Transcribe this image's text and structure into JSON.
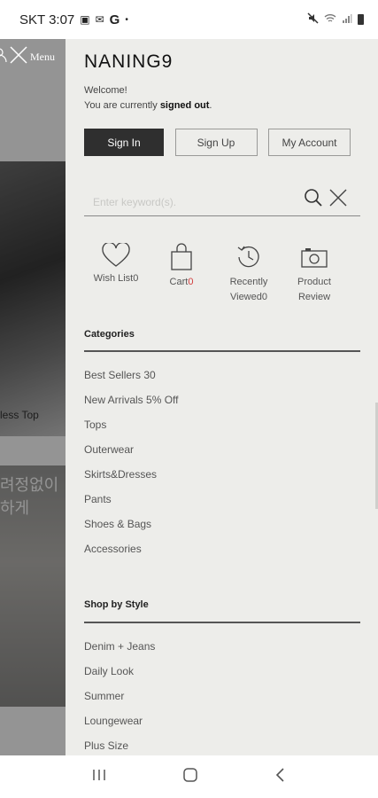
{
  "status_bar": {
    "carrier_time": "SKT 3:07",
    "g_icon": "G",
    "dot": "•"
  },
  "background": {
    "menu_label": "Menu",
    "caption": "less Top",
    "korean_text_line1": "려정없이",
    "korean_text_line2": "하게"
  },
  "drawer": {
    "brand": "NANING9",
    "welcome_line1": "Welcome!",
    "welcome_prefix": "You are currently ",
    "welcome_status": "signed out",
    "welcome_suffix": ".",
    "buttons": {
      "sign_in": "Sign In",
      "sign_up": "Sign Up",
      "my_account": "My Account"
    },
    "search": {
      "placeholder": "Enter keyword(s)."
    },
    "quick_links": {
      "wishlist_label": "Wish List",
      "wishlist_count": "0",
      "cart_label": "Cart",
      "cart_count": "0",
      "recent_line1": "Recently",
      "recent_line2": "Viewed",
      "recent_count": "0",
      "review_line1": "Product",
      "review_line2": "Review"
    },
    "categories_title": "Categories",
    "categories": [
      "Best Sellers 30",
      "New Arrivals 5% Off",
      "Tops",
      "Outerwear",
      "Skirts&Dresses",
      "Pants",
      "Shoes & Bags",
      "Accessories"
    ],
    "style_title": "Shop by Style",
    "styles": [
      "Denim + Jeans",
      "Daily Look",
      "Summer",
      "Loungewear",
      "Plus Size"
    ]
  },
  "colors": {
    "drawer_bg": "#ededea",
    "signin_bg": "#2f2f2f",
    "accent_red": "#d23d3d"
  }
}
